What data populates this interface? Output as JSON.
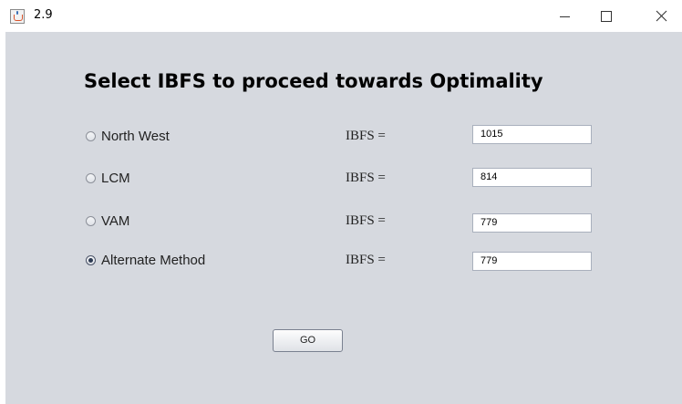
{
  "window": {
    "title": "2.9",
    "app_icon": "java-cup-icon",
    "controls": {
      "minimize_icon": "minimize-icon",
      "maximize_icon": "maximize-icon",
      "close_icon": "close-icon"
    }
  },
  "main": {
    "heading": "Select IBFS to proceed towards Optimality",
    "methods": [
      {
        "label": "North West",
        "selected": false,
        "ibfs_label": "IBFS =",
        "ibfs_value": "1015"
      },
      {
        "label": "LCM",
        "selected": false,
        "ibfs_label": "IBFS =",
        "ibfs_value": "814"
      },
      {
        "label": "VAM",
        "selected": false,
        "ibfs_label": "IBFS =",
        "ibfs_value": "779"
      },
      {
        "label": "Alternate Method",
        "selected": true,
        "ibfs_label": "IBFS =",
        "ibfs_value": "779"
      }
    ],
    "go_label": "GO"
  },
  "colors": {
    "panel_background": "#d6d9df",
    "titlebar_background": "#ffffff",
    "field_border": "#a9b0bd"
  }
}
